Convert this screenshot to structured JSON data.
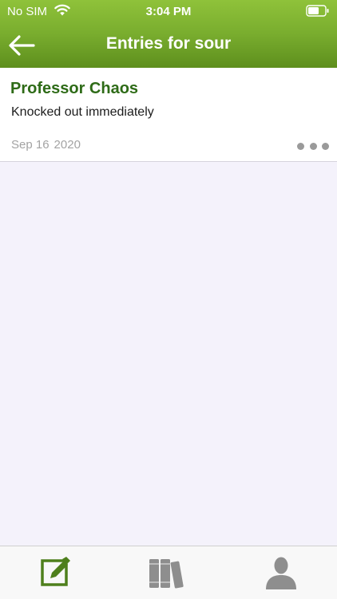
{
  "status_bar": {
    "carrier": "No SIM",
    "time": "3:04 PM",
    "wifi_icon": "wifi-icon",
    "battery_icon": "battery-icon"
  },
  "nav": {
    "title": "Entries for sour",
    "back_icon": "arrow-left-icon"
  },
  "entries": [
    {
      "title": "Professor Chaos",
      "body": "Knocked out immediately",
      "date_month_day": "Sep 16",
      "date_year": "2020",
      "menu_icon": "more-dots-icon"
    }
  ],
  "tab_bar": {
    "tabs": [
      {
        "icon": "edit-icon",
        "active": true
      },
      {
        "icon": "library-books-icon",
        "active": false
      },
      {
        "icon": "profile-icon",
        "active": false
      }
    ]
  },
  "colors": {
    "header_gradient_top": "#8fc23a",
    "header_gradient_bottom": "#5e8f1d",
    "entry_title": "#2e6b17",
    "tab_active": "#4e7f1c",
    "tab_inactive": "#8e8e8e",
    "background": "#f4f2fb"
  }
}
